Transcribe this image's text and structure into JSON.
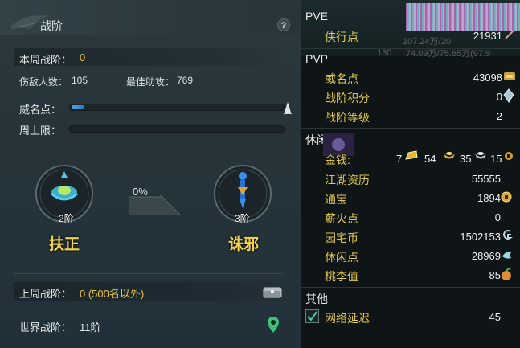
{
  "header": {
    "title": "战阶",
    "help": "?"
  },
  "weekly": {
    "label": "本周战阶：",
    "value": "0"
  },
  "kills": {
    "label": "伤敌人数：",
    "value": "105"
  },
  "assist": {
    "label": "最佳助攻：",
    "value": "769"
  },
  "prestige_bar": {
    "label": "威名点：",
    "fill": 0.06
  },
  "weekly_cap": {
    "label": "周上限：",
    "fill": 0.0
  },
  "ranks": {
    "left": {
      "level": "2阶",
      "name": "扶正"
    },
    "right": {
      "level": "3阶",
      "name": "诛邪"
    },
    "progress": "0%"
  },
  "last_week": {
    "label": "上周战阶：",
    "value": "0 (500名以外)"
  },
  "world": {
    "label": "世界战阶：",
    "value": "11阶"
  },
  "background": {
    "n1": "107.24万/20",
    "n2": "130",
    "n3": "74.09万/75.65万(97.9"
  },
  "stats": {
    "pve": {
      "title": "PVE",
      "items": [
        {
          "label": "侠行点",
          "value": "21931"
        }
      ]
    },
    "pvp": {
      "title": "PVP",
      "items": [
        {
          "label": "威名点",
          "value": "43098"
        },
        {
          "label": "战阶积分",
          "value": "0"
        },
        {
          "label": "战阶等级",
          "value": "2"
        }
      ]
    },
    "leisure": {
      "title": "休闲",
      "money": {
        "label": "金钱:",
        "a": "7",
        "b": "54",
        "c": "35",
        "d": "15"
      },
      "items": [
        {
          "label": "江湖资历",
          "value": "55555"
        },
        {
          "label": "通宝",
          "value": "1894"
        },
        {
          "label": "薪火点",
          "value": "0"
        },
        {
          "label": "园宅币",
          "value": "1502153"
        },
        {
          "label": "休闲点",
          "value": "28969"
        },
        {
          "label": "桃李值",
          "value": "85"
        }
      ]
    },
    "other": {
      "title": "其他",
      "items": [
        {
          "label": "网络延迟",
          "value": "45",
          "checked": true
        }
      ]
    }
  }
}
